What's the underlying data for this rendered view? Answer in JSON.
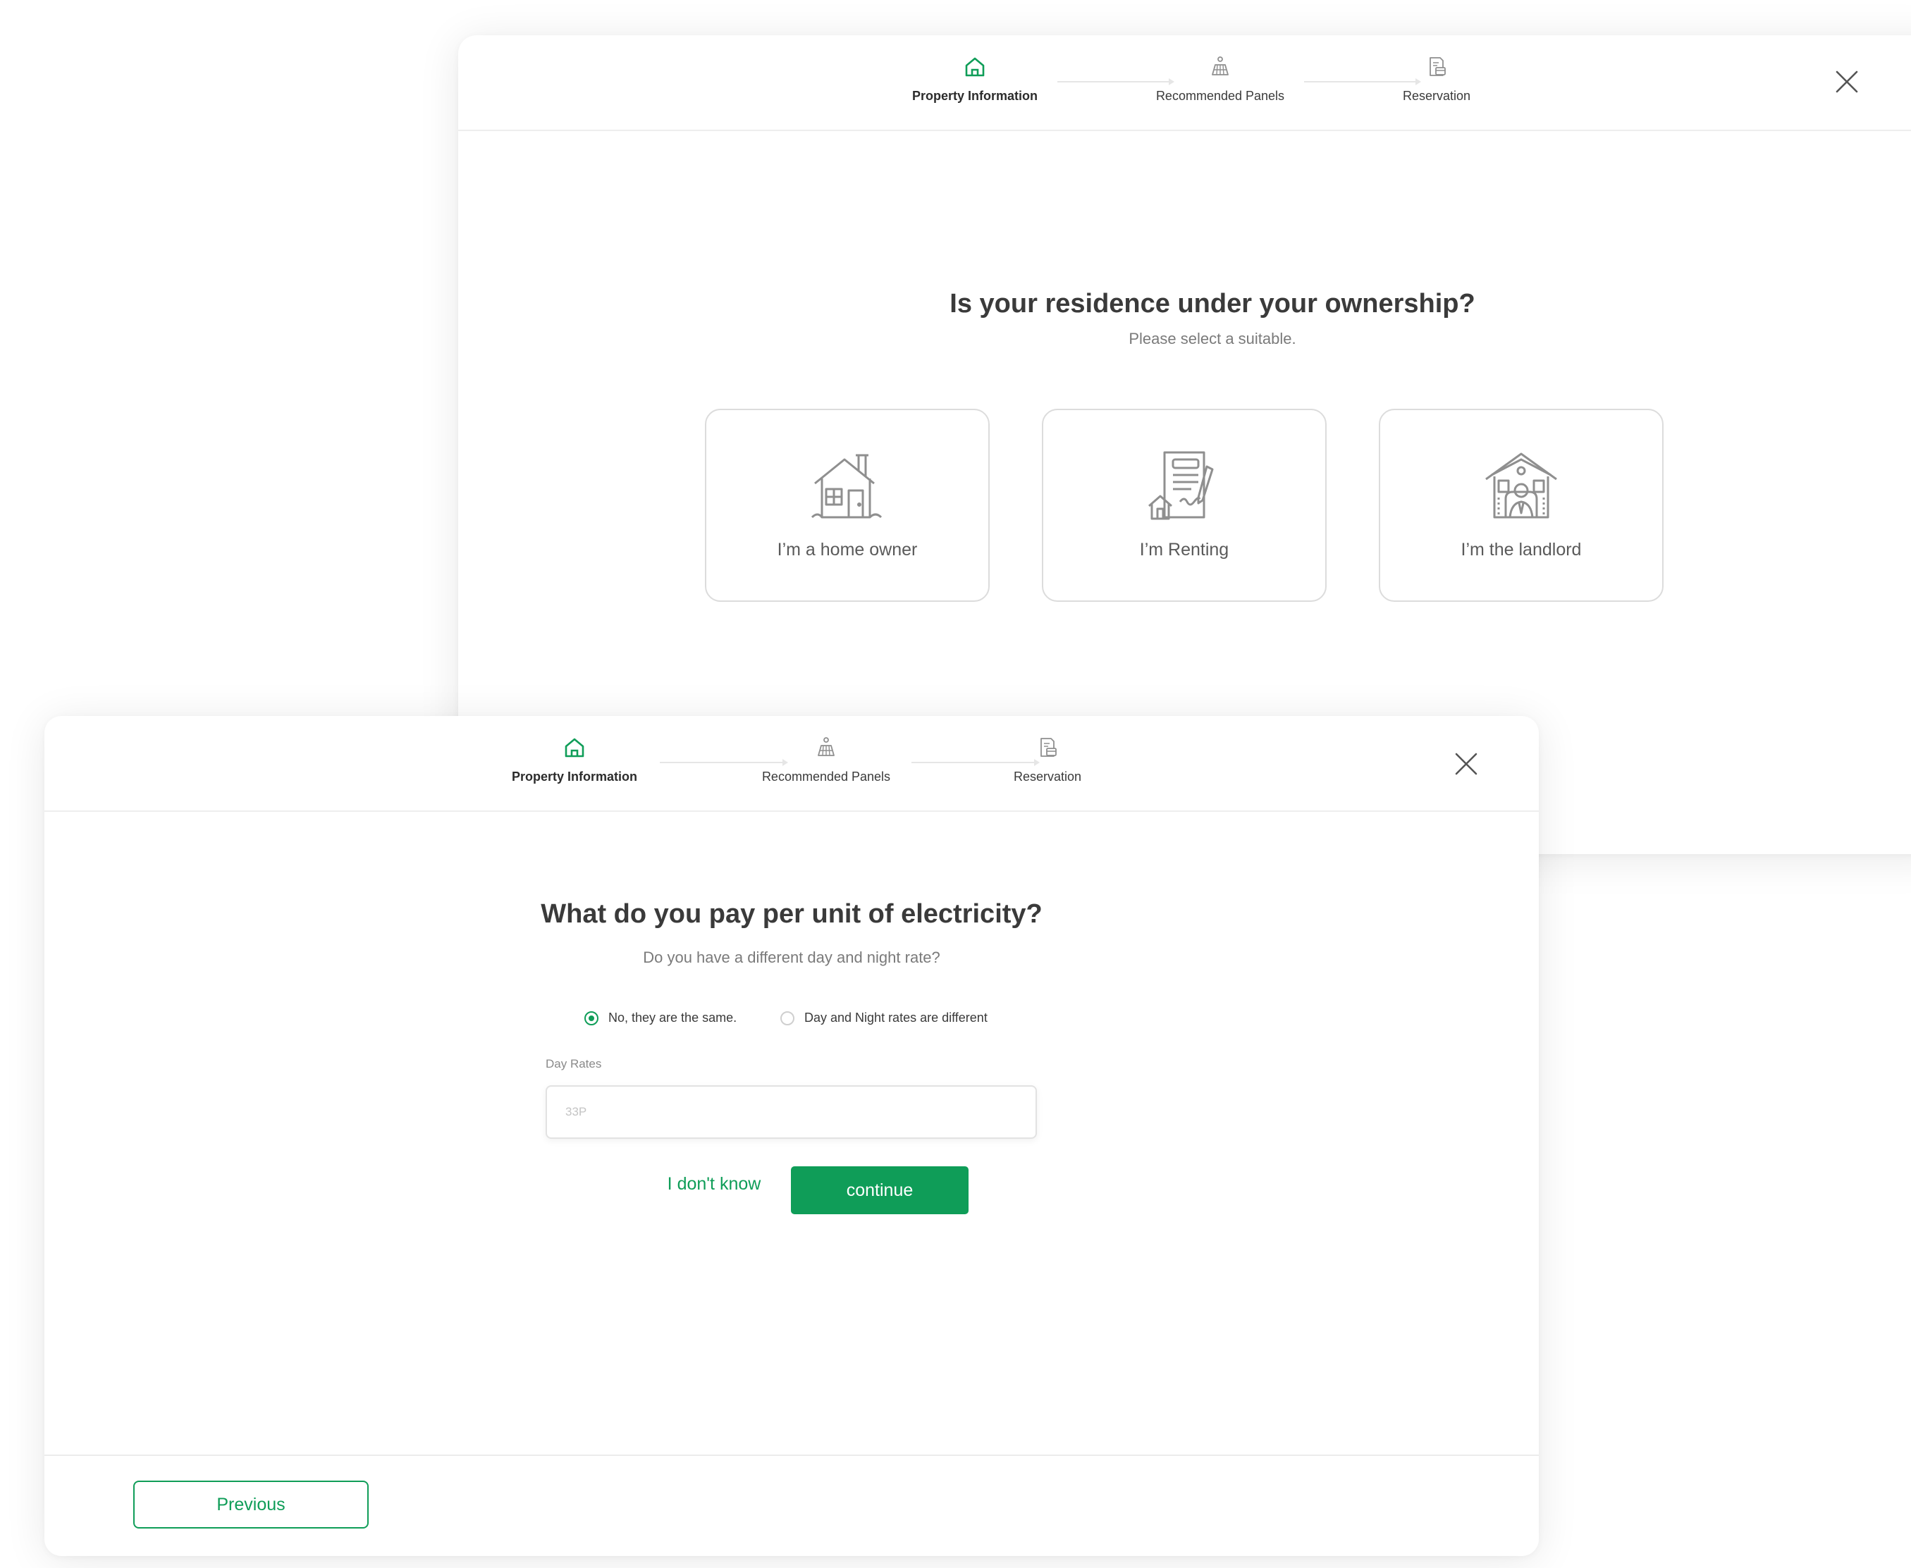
{
  "colors": {
    "accent": "#0f9d58",
    "text_dark": "#3a3a3a",
    "text_muted": "#7a7a7a",
    "border": "#dcdcdc",
    "icon_gray": "#8f8f8f"
  },
  "ownership_dialog": {
    "stepper": {
      "steps": [
        {
          "label": "Property Information",
          "icon": "home-icon",
          "active": true
        },
        {
          "label": "Recommended Panels",
          "icon": "solar-panel-icon",
          "active": false
        },
        {
          "label": "Reservation",
          "icon": "reservation-icon",
          "active": false
        }
      ]
    },
    "close_icon": "close-icon",
    "title": "Is your residence under your ownership?",
    "subtitle": "Please select a suitable.",
    "options": [
      {
        "label": "I’m a home owner",
        "icon": "house-icon"
      },
      {
        "label": "I’m Renting",
        "icon": "rental-contract-icon"
      },
      {
        "label": "I’m the landlord",
        "icon": "landlord-icon"
      }
    ]
  },
  "electricity_dialog": {
    "stepper": {
      "steps": [
        {
          "label": "Property Information",
          "icon": "home-icon",
          "active": true
        },
        {
          "label": "Recommended Panels",
          "icon": "solar-panel-icon",
          "active": false
        },
        {
          "label": "Reservation",
          "icon": "reservation-icon",
          "active": false
        }
      ]
    },
    "close_icon": "close-icon",
    "title": "What do you pay per unit of electricity?",
    "subtitle": "Do you have a different day and night rate?",
    "rate_options": [
      {
        "label": "No, they are the same.",
        "checked": true
      },
      {
        "label": "Day and Night rates are different",
        "checked": false
      }
    ],
    "day_rates": {
      "label": "Day Rates",
      "placeholder": "33P",
      "value": ""
    },
    "dont_know_label": "I don't know",
    "continue_label": "continue",
    "previous_label": "Previous"
  }
}
